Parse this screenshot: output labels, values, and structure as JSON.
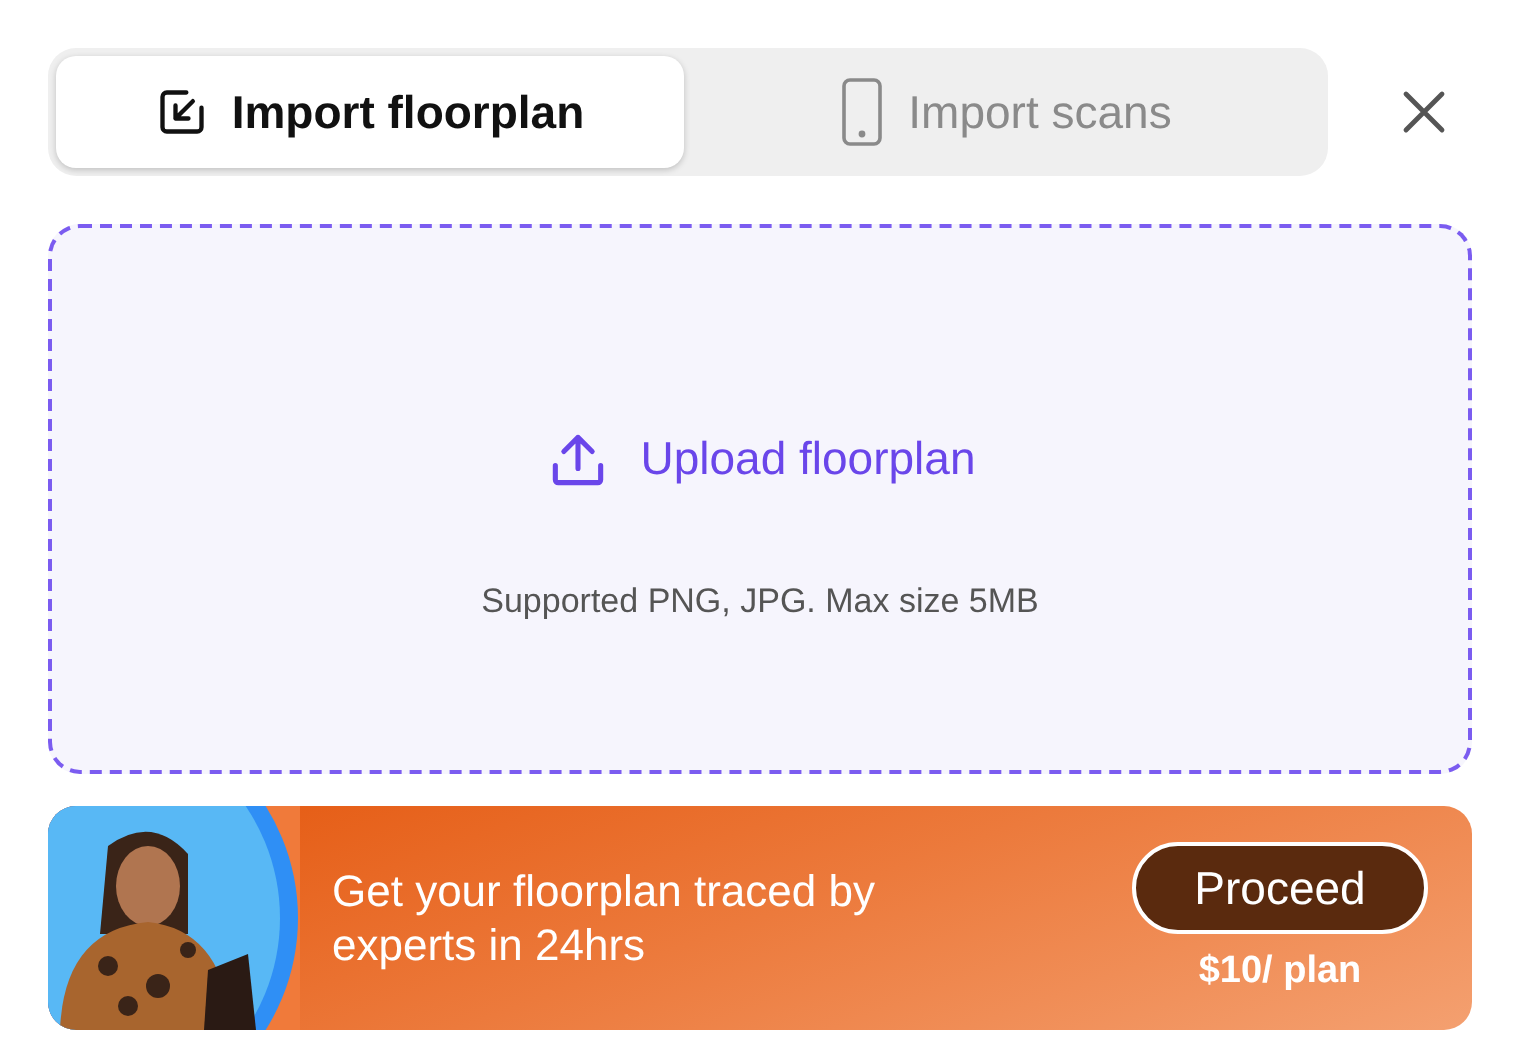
{
  "tabs": [
    {
      "label": "Import floorplan",
      "kind": "import",
      "selected": true
    },
    {
      "label": "Import scans",
      "kind": "phone",
      "selected": false
    }
  ],
  "dropzone": {
    "action": "Upload floorplan",
    "hint": "Supported PNG, JPG. Max size 5MB"
  },
  "promo": {
    "text": "Get your floorplan traced by experts in 24hrs",
    "button": "Proceed",
    "price": "$10/ plan"
  }
}
